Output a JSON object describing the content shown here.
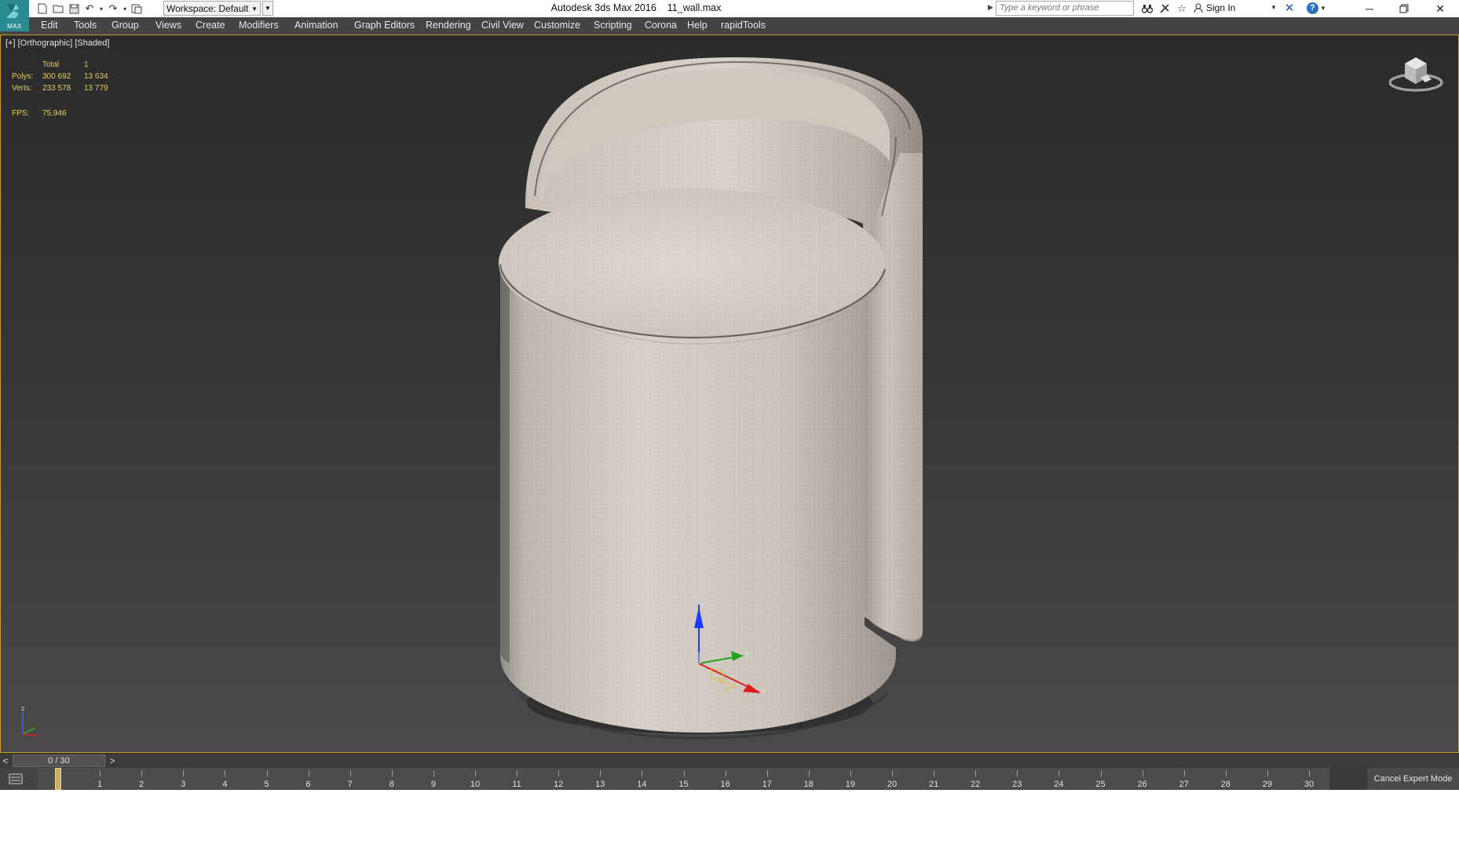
{
  "app": {
    "logo_text": "MAX",
    "workspace_label": "Workspace: Default",
    "title": "Autodesk 3ds Max 2016",
    "file_name": "11_wall.max",
    "search_placeholder": "Type a keyword or phrase",
    "sign_in_label": "Sign In"
  },
  "menu": [
    {
      "label": "Edit",
      "name": "menu-edit"
    },
    {
      "label": "Tools",
      "name": "menu-tools"
    },
    {
      "label": "Group",
      "name": "menu-group"
    },
    {
      "label": "Views",
      "name": "menu-views"
    },
    {
      "label": "Create",
      "name": "menu-create"
    },
    {
      "label": "Modifiers",
      "name": "menu-modifiers"
    },
    {
      "label": "Animation",
      "name": "menu-animation"
    },
    {
      "label": "Graph Editors",
      "name": "menu-graph-editors"
    },
    {
      "label": "Rendering",
      "name": "menu-rendering"
    },
    {
      "label": "Civil View",
      "name": "menu-civil-view"
    },
    {
      "label": "Customize",
      "name": "menu-customize"
    },
    {
      "label": "Scripting",
      "name": "menu-scripting"
    },
    {
      "label": "Corona",
      "name": "menu-corona"
    },
    {
      "label": "Help",
      "name": "menu-help"
    },
    {
      "label": "rapidTools",
      "name": "menu-rapidtools"
    }
  ],
  "viewport": {
    "label_plus": "[+]",
    "label_view": "[Orthographic]",
    "label_shading": "[Shaded]",
    "stats": {
      "total_label": "Total",
      "total_value": "1",
      "polys_label": "Polys:",
      "polys_total": "300 692",
      "polys_selected": "13 634",
      "verts_label": "Verts:",
      "verts_total": "233 578",
      "verts_selected": "13 779",
      "fps_label": "FPS:",
      "fps_value": "75,946"
    },
    "gizmo_labels": {
      "z": "z",
      "y": "y",
      "x": "x"
    }
  },
  "timeline": {
    "frame_display": "0 / 30",
    "prev_label": "<",
    "next_label": ">",
    "current_frame": 0,
    "ticks": [
      "0",
      "1",
      "2",
      "3",
      "4",
      "5",
      "6",
      "7",
      "8",
      "9",
      "10",
      "11",
      "12",
      "13",
      "14",
      "15",
      "16",
      "17",
      "18",
      "19",
      "20",
      "21",
      "22",
      "23",
      "24",
      "25",
      "26",
      "27",
      "28",
      "29",
      "30"
    ],
    "cancel_expert_label": "Cancel Expert Mode"
  },
  "colors": {
    "accent_gold": "#c99d2e",
    "stats_text": "#e3cc62",
    "logo_teal": "#2a8c92",
    "viewport_top": "#2b2b2b",
    "viewport_bottom": "#4a4a4a"
  },
  "icons": [
    "new-file-icon",
    "open-file-icon",
    "save-icon",
    "undo-icon",
    "redo-icon",
    "project-folder-icon",
    "binoculars-icon",
    "communication-center-icon",
    "favorites-star-icon",
    "user-icon",
    "exchange-x-icon",
    "help-icon",
    "minimize-icon",
    "restore-icon",
    "close-icon",
    "viewcube-icon",
    "axis-tripod-icon",
    "transform-gizmo-icon",
    "mini-curve-editor-icon"
  ]
}
